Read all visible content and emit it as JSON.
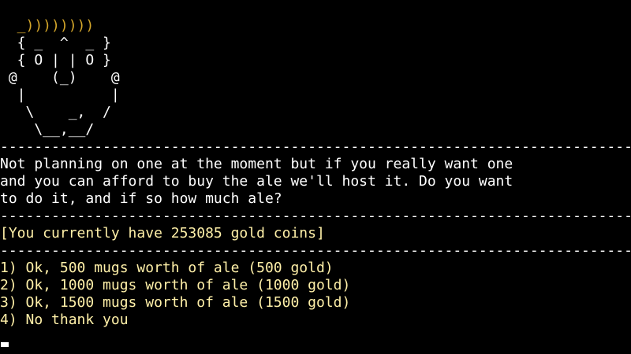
{
  "portrait": {
    "hair": "  _))))))))",
    "lines": [
      "  { _  ^  _ }",
      "  { O | | O }",
      " @    (_)    @",
      "  |          |",
      "   \\    _,  /",
      "    \\__,__/"
    ]
  },
  "divider": "--------------------------------------------------------------------------------",
  "dialog": {
    "lines": [
      "Not planning on one at the moment but if you really want one",
      "and you can afford to buy the ale we'll host it. Do you want",
      "to do it, and if so how much ale?"
    ]
  },
  "status": "[You currently have 253085 gold coins]",
  "choices": [
    "1) Ok, 500 mugs worth of ale (500 gold)",
    "2) Ok, 1000 mugs worth of ale (1000 gold)",
    "3) Ok, 1500 mugs worth of ale (1500 gold)",
    "4) No thank you"
  ],
  "colors": {
    "background": "#000000",
    "text": "#ffffff",
    "hair": "#d4a62a",
    "highlight": "#fff0a8"
  }
}
